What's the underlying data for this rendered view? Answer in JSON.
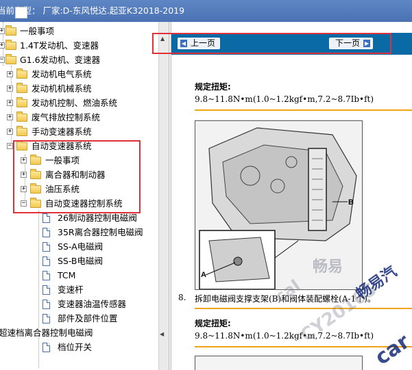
{
  "titlebar": {
    "title": "当前车型：  厂家:D-东风悦达.起亚K32018-2019"
  },
  "tree": {
    "items": [
      {
        "label": "一般事项",
        "level": 0,
        "type": "folder",
        "expander": "+"
      },
      {
        "label": "1.4T发动机、变速器",
        "level": 0,
        "type": "folder",
        "expander": "+"
      },
      {
        "label": "G1.6发动机、变速器",
        "level": 0,
        "type": "folder",
        "expander": "-"
      },
      {
        "label": "发动机电气系统",
        "level": 1,
        "type": "folder",
        "expander": "+"
      },
      {
        "label": "发动机机械系统",
        "level": 1,
        "type": "folder",
        "expander": "+"
      },
      {
        "label": "发动机控制、燃油系统",
        "level": 1,
        "type": "folder",
        "expander": "+"
      },
      {
        "label": "废气排放控制系统",
        "level": 1,
        "type": "folder",
        "expander": "+"
      },
      {
        "label": "手动变速器系统",
        "level": 1,
        "type": "folder",
        "expander": "+"
      },
      {
        "label": "自动变速器系统",
        "level": 1,
        "type": "folder",
        "expander": "-"
      },
      {
        "label": "一般事项",
        "level": 2,
        "type": "folder",
        "expander": "+"
      },
      {
        "label": "离合器和制动器",
        "level": 2,
        "type": "folder",
        "expander": "+"
      },
      {
        "label": "油压系统",
        "level": 2,
        "type": "folder",
        "expander": "+"
      },
      {
        "label": "自动变速器控制系统",
        "level": 2,
        "type": "folder",
        "expander": "-"
      },
      {
        "label": "26制动器控制电磁阀",
        "level": 3,
        "type": "doc"
      },
      {
        "label": "35R离合器控制电磁阀",
        "level": 3,
        "type": "doc"
      },
      {
        "label": "SS-A电磁阀",
        "level": 3,
        "type": "doc"
      },
      {
        "label": "SS-B电磁阀",
        "level": 3,
        "type": "doc"
      },
      {
        "label": "TCM",
        "level": 3,
        "type": "doc"
      },
      {
        "label": "变速杆",
        "level": 3,
        "type": "doc"
      },
      {
        "label": "变速器油温传感器",
        "level": 3,
        "type": "doc"
      },
      {
        "label": "部件及部件位置",
        "level": 3,
        "type": "doc"
      },
      {
        "label": "超速档离合器控制电磁阀",
        "level": 3,
        "type": "doc"
      },
      {
        "label": "档位开关",
        "level": 3,
        "type": "doc"
      }
    ]
  },
  "nav": {
    "prev": "上一页",
    "next": "下一页"
  },
  "content": {
    "torque_label": "规定扭矩:",
    "torque_value": "9.8~11.8N•m(1.0~1.2kgf•m,7.2~8.7Ib•ft)",
    "step_number": "8.",
    "step_text": "拆卸电磁阀支撑支架(B)和阀体装配螺栓(A-1个)。",
    "torque_label_2": "规定扭矩:",
    "torque_value_2": "9.8~11.8N•m(1.0~1.2kgf•m,7.2~8.7Ib•ft)",
    "callout_a": "A",
    "callout_b": "B"
  },
  "watermark": {
    "line1": "畅易",
    "line2": "cal",
    "line3": "CY20165",
    "line4": "畅易汽",
    "line5": "car"
  },
  "colors": {
    "nav_bar": "#0a6aa6",
    "highlight": "#e0303a",
    "accent_line": "#f0a315"
  }
}
